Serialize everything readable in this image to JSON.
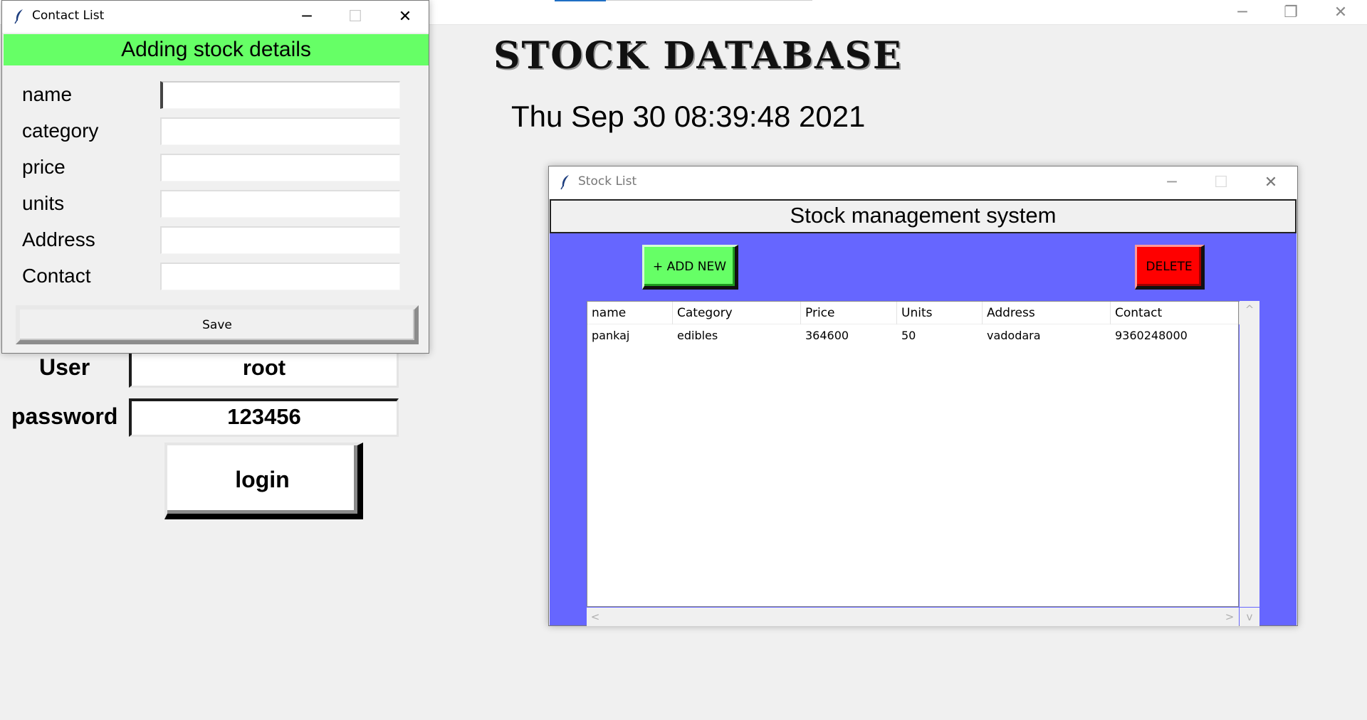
{
  "main_window": {
    "controls": {
      "minimize": "─",
      "restore": "❐",
      "close": "✕"
    },
    "title": "STOCK DATABASE",
    "clock": "Thu Sep 30 08:39:48 2021",
    "login": {
      "user_label": "User",
      "user_value": "root",
      "password_label": "password",
      "password_value": "123456",
      "login_button": "login"
    }
  },
  "contact_dialog": {
    "title": "Contact List",
    "controls": {
      "minimize": "─",
      "maximize": "☐",
      "close": "✕"
    },
    "header": "Adding stock details",
    "header_color": "#66ff66",
    "fields": [
      {
        "label": "name",
        "value": ""
      },
      {
        "label": "category",
        "value": ""
      },
      {
        "label": "price",
        "value": ""
      },
      {
        "label": "units",
        "value": ""
      },
      {
        "label": "Address",
        "value": ""
      },
      {
        "label": "Contact",
        "value": ""
      }
    ],
    "save_button": "Save"
  },
  "stock_window": {
    "title": "Stock List",
    "controls": {
      "minimize": "─",
      "maximize": "☐",
      "close": "✕"
    },
    "header": "Stock management system",
    "body_color": "#6666ff",
    "add_button": "+ ADD NEW",
    "add_button_color": "#66ff66",
    "delete_button": "DELETE",
    "delete_button_color": "#ff0000",
    "table": {
      "columns": [
        "name",
        "Category",
        "Price",
        "Units",
        "Address",
        "Contact"
      ],
      "rows": [
        [
          "pankaj",
          "edibles",
          "364600",
          "50",
          "vadodara",
          "9360248000"
        ]
      ]
    },
    "scroll": {
      "up": "^",
      "down": "v",
      "left": "<",
      "right": ">"
    }
  }
}
